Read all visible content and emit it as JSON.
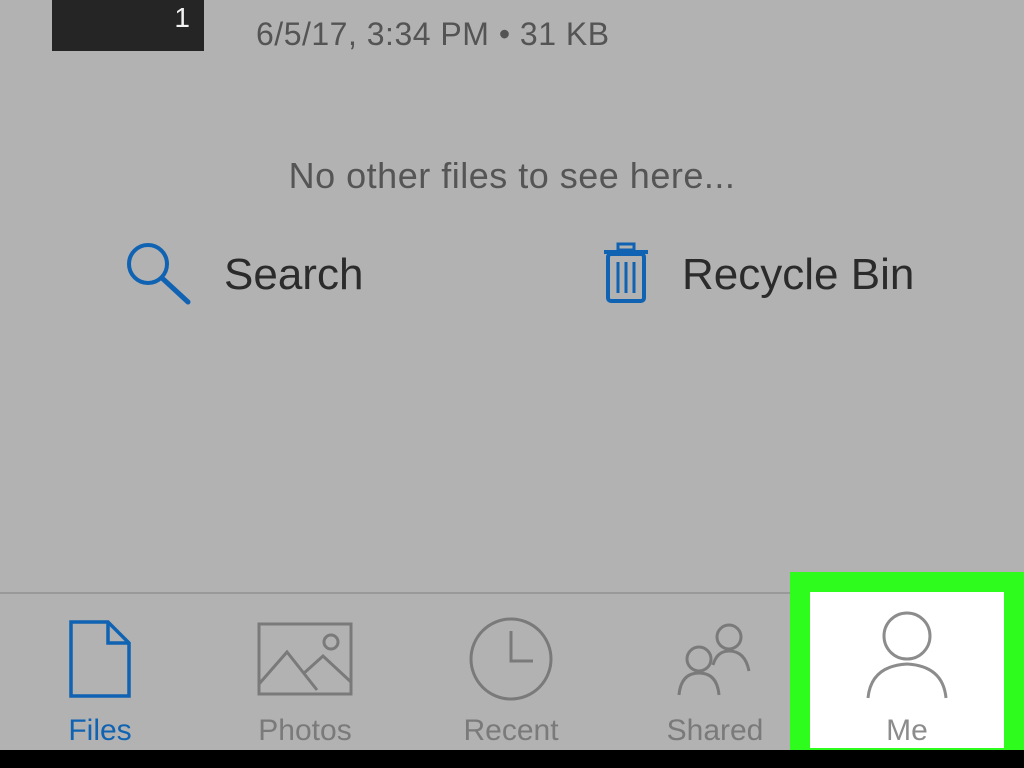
{
  "file": {
    "thumb_count": "1",
    "meta": "6/5/17, 3:34 PM • 31 KB"
  },
  "empty_message": "No other files to see here...",
  "actions": {
    "search_label": "Search",
    "recycle_label": "Recycle Bin"
  },
  "tabs": [
    {
      "label": "Files",
      "icon": "file-icon",
      "active": true
    },
    {
      "label": "Photos",
      "icon": "photo-icon",
      "active": false
    },
    {
      "label": "Recent",
      "icon": "clock-icon",
      "active": false
    },
    {
      "label": "Shared",
      "icon": "people-icon",
      "active": false
    },
    {
      "label": "Me",
      "icon": "person-icon",
      "active": false,
      "highlighted": true
    }
  ],
  "colors": {
    "background": "#b2b2b2",
    "accent": "#1063b2",
    "highlight": "#2dfc1d",
    "inactive": "#7a7a7a"
  }
}
